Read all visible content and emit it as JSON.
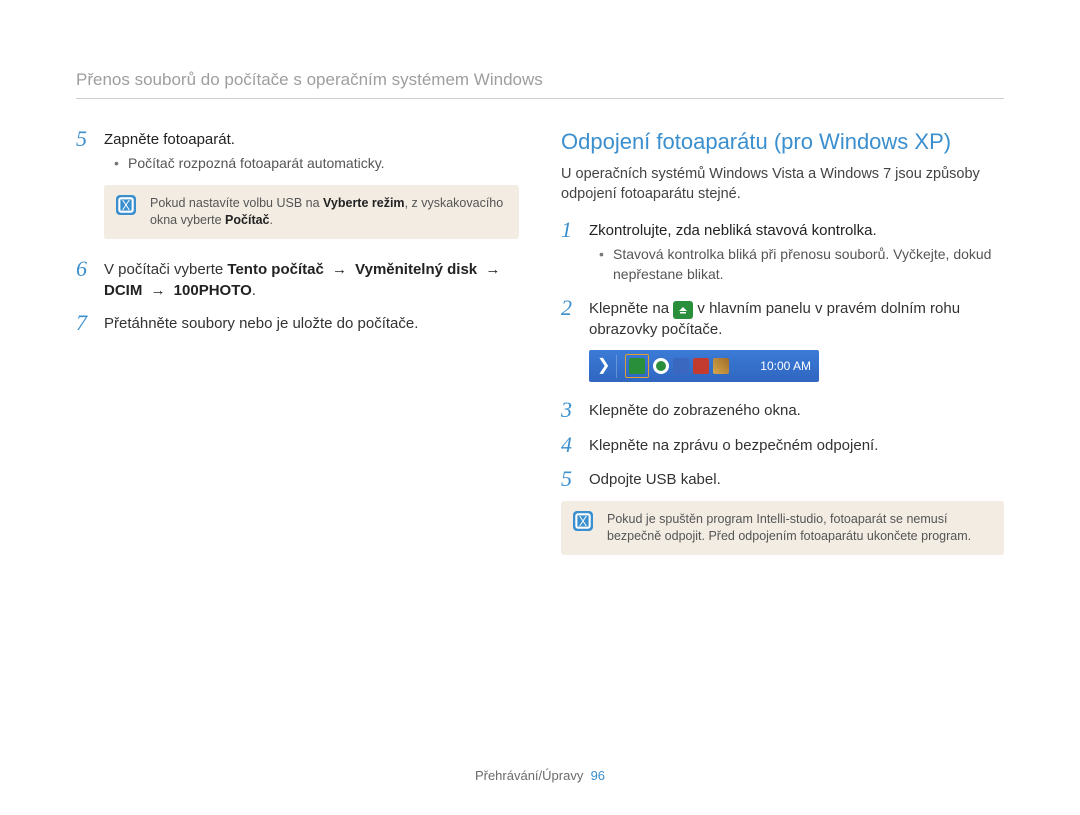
{
  "header": "Přenos souborů do počítače s operačním systémem Windows",
  "left": {
    "step5": {
      "num": "5",
      "text": "Zapněte fotoaparát.",
      "bullet": "Počítač rozpozná fotoaparát automaticky."
    },
    "note1_part1": "Pokud nastavíte volbu USB na ",
    "note1_bold1": "Vyberte režim",
    "note1_part2": ", z vyskakovacího okna vyberte ",
    "note1_bold2": "Počítač",
    "note1_part3": ".",
    "step6": {
      "num": "6",
      "prefix": "V počítači vyberte ",
      "p1": "Tento počítač",
      "p2": "Vyměnitelný disk",
      "p3": "DCIM",
      "p4": "100PHOTO",
      "suffix": "."
    },
    "step7": {
      "num": "7",
      "text": "Přetáhněte soubory nebo je uložte do počítače."
    }
  },
  "right": {
    "title": "Odpojení fotoaparátu (pro Windows XP)",
    "intro": "U operačních systémů Windows Vista a Windows 7 jsou způsoby odpojení fotoaparátu stejné.",
    "step1": {
      "num": "1",
      "text": "Zkontrolujte, zda nebliká stavová kontrolka.",
      "bullet": "Stavová kontrolka bliká při přenosu souborů. Vyčkejte, dokud nepřestane blikat."
    },
    "step2": {
      "num": "2",
      "prefix": "Klepněte na ",
      "suffix": " v hlavním panelu v pravém dolním rohu obrazovky počítače."
    },
    "taskbar_time": "10:00 AM",
    "step3": {
      "num": "3",
      "text": "Klepněte do zobrazeného okna."
    },
    "step4": {
      "num": "4",
      "text": "Klepněte na zprávu o bezpečném odpojení."
    },
    "step5": {
      "num": "5",
      "text": "Odpojte USB kabel."
    },
    "note2": "Pokud je spuštěn program Intelli-studio, fotoaparát se nemusí bezpečně odpojit. Před odpojením fotoaparátu ukončete program."
  },
  "footer": {
    "section": "Přehrávání/Úpravy",
    "page": "96"
  },
  "arrow_glyph": "→"
}
